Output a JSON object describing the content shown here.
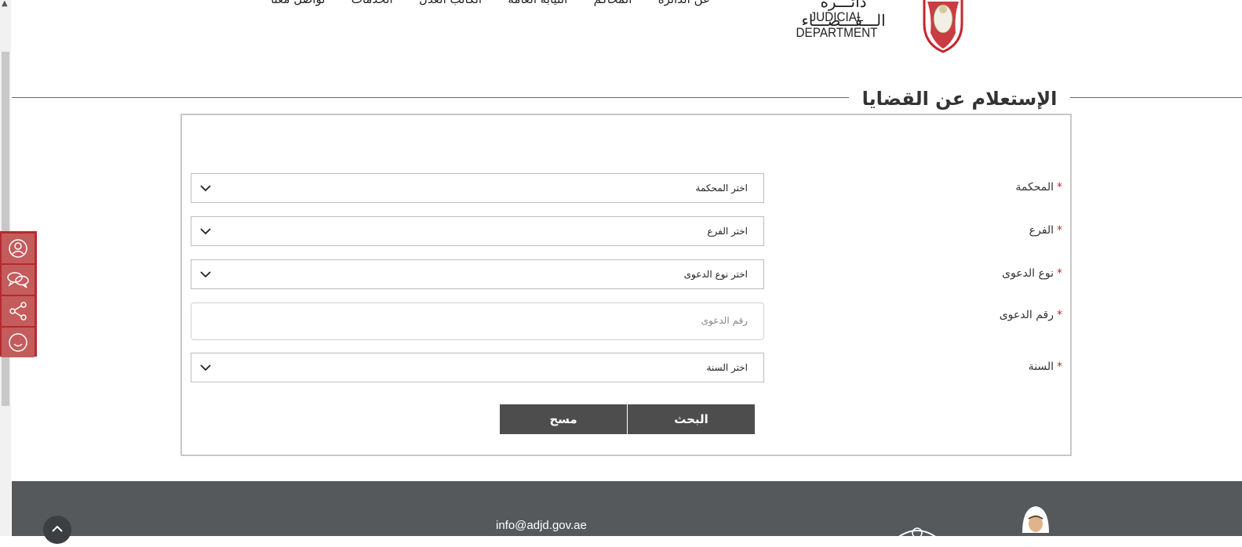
{
  "nav": {
    "items": [
      "عن الدائرة",
      "المحاكم",
      "النيابة العامة",
      "الكاتب العدل",
      "الخدمات",
      "تواصل معنا"
    ]
  },
  "logo": {
    "arabic": "دائـــرة الـــقـــضـــاء",
    "english": "JUDICIAL DEPARTMENT"
  },
  "page": {
    "title": "الإستعلام عن القضايا"
  },
  "form": {
    "required_mark": "*",
    "court": {
      "label": "المحكمة",
      "value": "اختر المحكمة"
    },
    "branch": {
      "label": "الفرع",
      "value": "اختر الفرع"
    },
    "case_type": {
      "label": "نوع الدعوى",
      "value": "اختر نوع الدعوى"
    },
    "case_number": {
      "label": "رقم الدعوى",
      "placeholder": "رقم الدعوى"
    },
    "year": {
      "label": "السنة",
      "value": "اختر السنة"
    },
    "search_label": "البحث",
    "clear_label": "مسح"
  },
  "social": {
    "icons": [
      "user-icon",
      "chat-icon",
      "share-icon",
      "smile-icon"
    ]
  },
  "footer": {
    "email": "info@adjd.gov.ae"
  },
  "colors": {
    "accent": "#b52a2f",
    "button": "#4d4d4d",
    "footer": "#55595c",
    "required": "#c4262e"
  }
}
